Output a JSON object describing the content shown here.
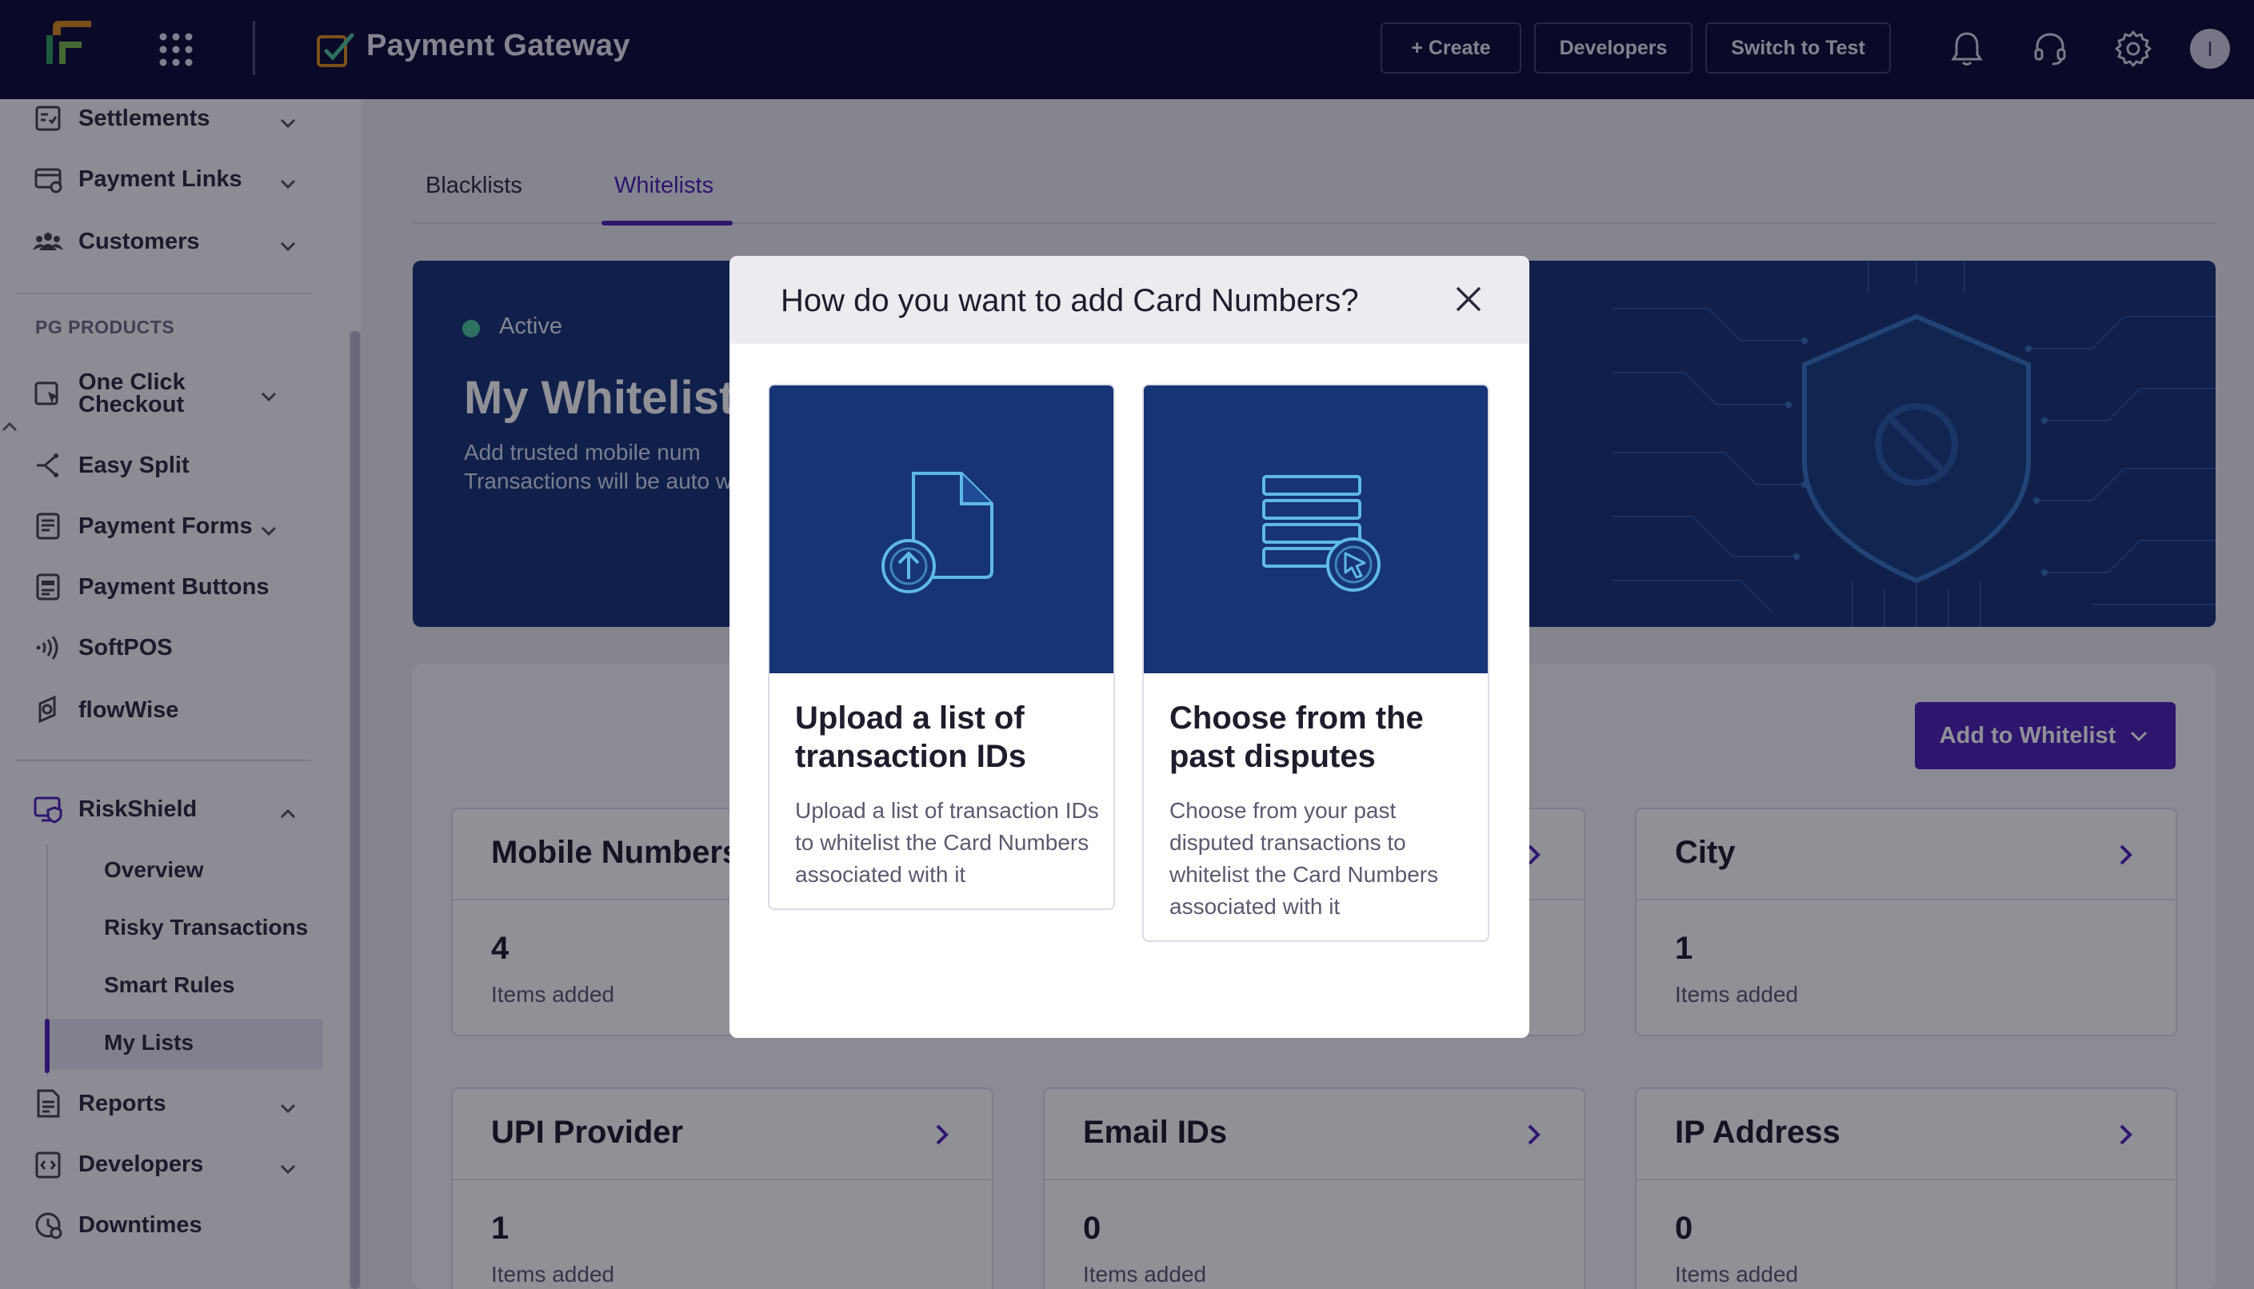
{
  "topbar": {
    "app_title": "Payment Gateway",
    "create_label": "+ Create",
    "developers_label": "Developers",
    "switch_label": "Switch to Test",
    "avatar_initial": "I"
  },
  "sidebar": {
    "items_top": [
      {
        "label": "Settlements",
        "icon": "settlements-icon"
      },
      {
        "label": "Payment Links",
        "icon": "payment-links-icon"
      },
      {
        "label": "Customers",
        "icon": "customers-icon"
      }
    ],
    "section_label": "PG PRODUCTS",
    "products": [
      {
        "label_line1": "One Click",
        "label_line2": "Checkout",
        "icon": "one-click-checkout-icon"
      },
      {
        "label": "Easy Split",
        "icon": "easy-split-icon"
      },
      {
        "label": "Payment Forms",
        "icon": "payment-forms-icon"
      },
      {
        "label": "Payment Buttons",
        "icon": "payment-buttons-icon"
      },
      {
        "label": "SoftPOS",
        "icon": "softpos-icon"
      },
      {
        "label": "flowWise",
        "icon": "flowwise-icon"
      }
    ],
    "riskshield": {
      "label": "RiskShield",
      "sub_items": [
        "Overview",
        "Risky Transactions",
        "Smart Rules",
        "My Lists"
      ],
      "active_sub": "My Lists"
    },
    "items_bottom": [
      {
        "label": "Reports",
        "icon": "reports-icon"
      },
      {
        "label": "Developers",
        "icon": "developers-icon"
      },
      {
        "label": "Downtimes",
        "icon": "downtimes-icon"
      }
    ]
  },
  "main": {
    "tabs": [
      {
        "label": "Blacklists",
        "active": false
      },
      {
        "label": "Whitelists",
        "active": true
      }
    ],
    "banner": {
      "status": "Active",
      "title": "My Whitelist",
      "description": "Add trusted mobile num Transactions will be auto whitelist."
    },
    "add_button_label": "Add to Whitelist",
    "cards": [
      {
        "title": "Mobile Numbers",
        "count": "4",
        "sub": "Items added"
      },
      {
        "title": "City",
        "count": "1",
        "sub": "Items added"
      },
      {
        "title": "UPI Provider",
        "count": "1",
        "sub": "Items added"
      },
      {
        "title": "Email IDs",
        "count": "0",
        "sub": "Items added"
      },
      {
        "title": "IP Address",
        "count": "0",
        "sub": "Items added"
      }
    ]
  },
  "modal": {
    "title": "How do you want to add Card Numbers?",
    "options": [
      {
        "title": "Upload a list of transaction IDs",
        "description": "Upload a list of transaction IDs to whitelist the Card Numbers associated with it",
        "icon": "file-upload-icon"
      },
      {
        "title": "Choose from the past disputes",
        "description": "Choose from your past disputed transactions to whitelist the Card Numbers associated with it",
        "icon": "list-select-icon"
      }
    ]
  },
  "colors": {
    "topbar_bg": "#0b0a36",
    "accent": "#4d1fb3",
    "banner_bg": "#163476",
    "status_green": "#4cc79d"
  }
}
